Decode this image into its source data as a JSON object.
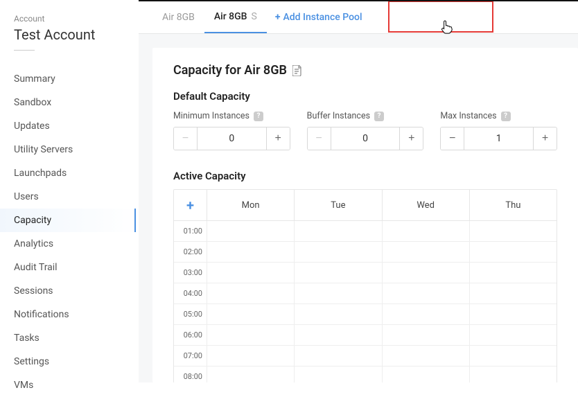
{
  "sidebar": {
    "account_label": "Account",
    "account_name": "Test Account",
    "items": [
      {
        "label": "Summary"
      },
      {
        "label": "Sandbox"
      },
      {
        "label": "Updates"
      },
      {
        "label": "Utility Servers"
      },
      {
        "label": "Launchpads"
      },
      {
        "label": "Users"
      },
      {
        "label": "Capacity",
        "active": true
      },
      {
        "label": "Analytics"
      },
      {
        "label": "Audit Trail"
      },
      {
        "label": "Sessions"
      },
      {
        "label": "Notifications"
      },
      {
        "label": "Tasks"
      },
      {
        "label": "Settings"
      },
      {
        "label": "VMs"
      }
    ]
  },
  "tabs": {
    "items": [
      {
        "label": "Air 8GB",
        "active": false
      },
      {
        "label": "Air 8GB",
        "suffix": "S",
        "active": true
      }
    ],
    "add_label": "Add Instance Pool"
  },
  "capacity": {
    "title": "Capacity for Air 8GB",
    "default_section": "Default Capacity",
    "fields": {
      "min": {
        "label": "Minimum Instances",
        "value": "0",
        "dec_disabled": true
      },
      "buffer": {
        "label": "Buffer Instances",
        "value": "0",
        "dec_disabled": true
      },
      "max": {
        "label": "Max Instances",
        "value": "1",
        "dec_disabled": false
      }
    },
    "active_section": "Active Capacity",
    "days": [
      "Mon",
      "Tue",
      "Wed",
      "Thu"
    ],
    "hours": [
      "01:00",
      "02:00",
      "03:00",
      "04:00",
      "05:00",
      "06:00",
      "07:00",
      "08:00"
    ]
  }
}
